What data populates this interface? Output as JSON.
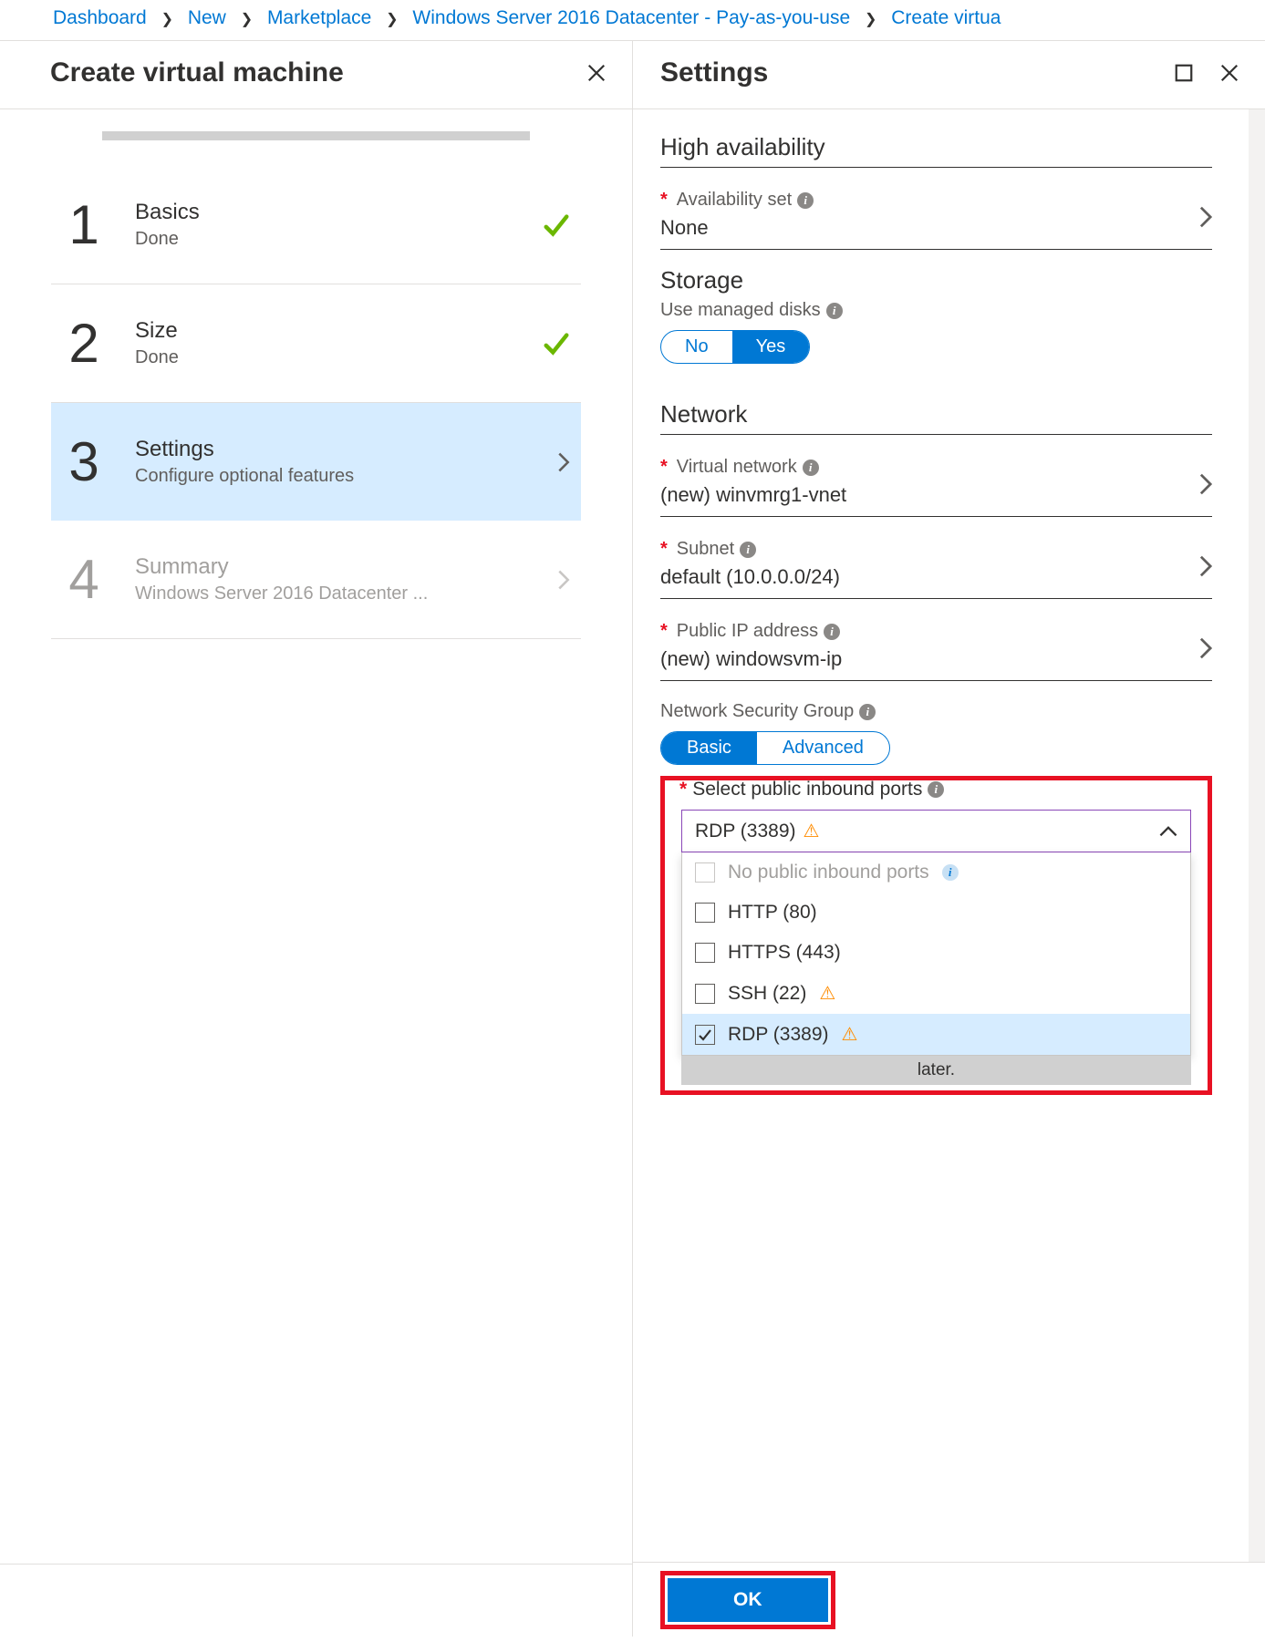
{
  "breadcrumb": {
    "items": [
      "Dashboard",
      "New",
      "Marketplace",
      "Windows Server 2016 Datacenter - Pay-as-you-use",
      "Create virtua"
    ]
  },
  "left_blade": {
    "title": "Create virtual machine",
    "steps": [
      {
        "num": "1",
        "title": "Basics",
        "sub": "Done",
        "state": "done"
      },
      {
        "num": "2",
        "title": "Size",
        "sub": "Done",
        "state": "done"
      },
      {
        "num": "3",
        "title": "Settings",
        "sub": "Configure optional features",
        "state": "active"
      },
      {
        "num": "4",
        "title": "Summary",
        "sub": "Windows Server 2016 Datacenter ...",
        "state": "disabled"
      }
    ]
  },
  "right_blade": {
    "title": "Settings",
    "sections": {
      "ha": {
        "heading": "High availability",
        "availability_set_label": "Availability set",
        "availability_set_value": "None"
      },
      "storage": {
        "heading": "Storage",
        "managed_label": "Use managed disks",
        "options": {
          "no": "No",
          "yes": "Yes"
        }
      },
      "network": {
        "heading": "Network",
        "vnet_label": "Virtual network",
        "vnet_value": "(new) winvmrg1-vnet",
        "subnet_label": "Subnet",
        "subnet_value": "default (10.0.0.0/24)",
        "pip_label": "Public IP address",
        "pip_value": "(new) windowsvm-ip",
        "nsg_label": "Network Security Group",
        "nsg_options": {
          "basic": "Basic",
          "advanced": "Advanced"
        },
        "ports_label": "Select public inbound ports",
        "ports_selected": "RDP (3389)",
        "ports_options": [
          {
            "label": "No public inbound ports",
            "warn": false,
            "disabled": true,
            "checked": false,
            "info": true
          },
          {
            "label": "HTTP (80)",
            "warn": false,
            "disabled": false,
            "checked": false
          },
          {
            "label": "HTTPS (443)",
            "warn": false,
            "disabled": false,
            "checked": false
          },
          {
            "label": "SSH (22)",
            "warn": true,
            "disabled": false,
            "checked": false
          },
          {
            "label": "RDP (3389)",
            "warn": true,
            "disabled": false,
            "checked": true
          }
        ],
        "later_text": "later."
      }
    },
    "ok_label": "OK"
  }
}
